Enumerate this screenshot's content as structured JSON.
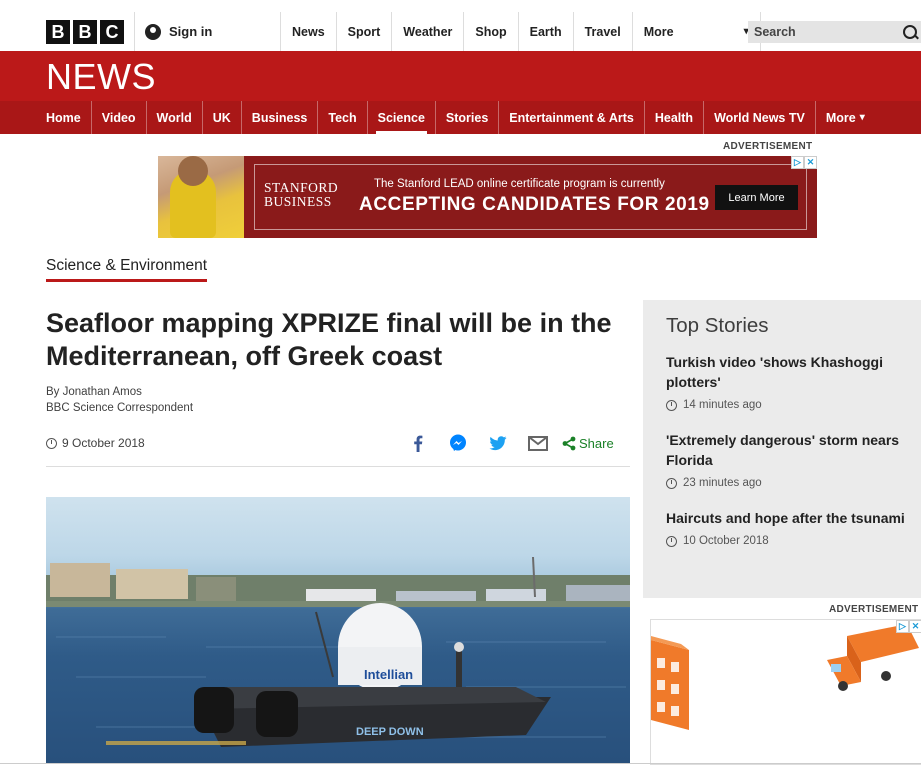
{
  "header": {
    "logo_letters": [
      "B",
      "B",
      "C"
    ],
    "signin_label": "Sign in",
    "nav": [
      "News",
      "Sport",
      "Weather",
      "Shop",
      "Earth",
      "Travel"
    ],
    "more_label": "More",
    "search_placeholder": "Search"
  },
  "news_band": {
    "title": "NEWS",
    "nav": [
      "Home",
      "Video",
      "World",
      "UK",
      "Business",
      "Tech",
      "Science",
      "Stories",
      "Entertainment & Arts",
      "Health",
      "World News TV"
    ],
    "more_label": "More",
    "active": "Science"
  },
  "ad_top": {
    "label": "ADVERTISEMENT",
    "brand_line1": "STANFORD",
    "brand_line2": "BUSINESS",
    "line1": "The Stanford LEAD online certificate program is currently",
    "line2": "ACCEPTING CANDIDATES FOR 2019",
    "cta": "Learn More"
  },
  "section": "Science & Environment",
  "article": {
    "headline": "Seafloor mapping XPRIZE final will be in the Mediterranean, off Greek coast",
    "author": "By Jonathan Amos",
    "role": "BBC Science Correspondent",
    "date": "9 October 2018",
    "share_label": "Share",
    "image_texts": {
      "dome_brand": "Intellian",
      "hull_text": "DEEP DOWN"
    }
  },
  "top_stories": {
    "title": "Top Stories",
    "items": [
      {
        "title": "Turkish video 'shows Khashoggi plotters'",
        "time": "14 minutes ago"
      },
      {
        "title": "'Extremely dangerous' storm nears Florida",
        "time": "23 minutes ago"
      },
      {
        "title": "Haircuts and hope after the tsunami",
        "time": "10 October 2018"
      }
    ]
  },
  "ad_side": {
    "label": "ADVERTISEMENT"
  },
  "colors": {
    "bbc_red": "#bb1919",
    "nav_red": "#a91717",
    "share_green": "#1b8128",
    "facebook_blue": "#3b5998",
    "messenger_blue": "#0084ff",
    "twitter_blue": "#1da1f2"
  }
}
